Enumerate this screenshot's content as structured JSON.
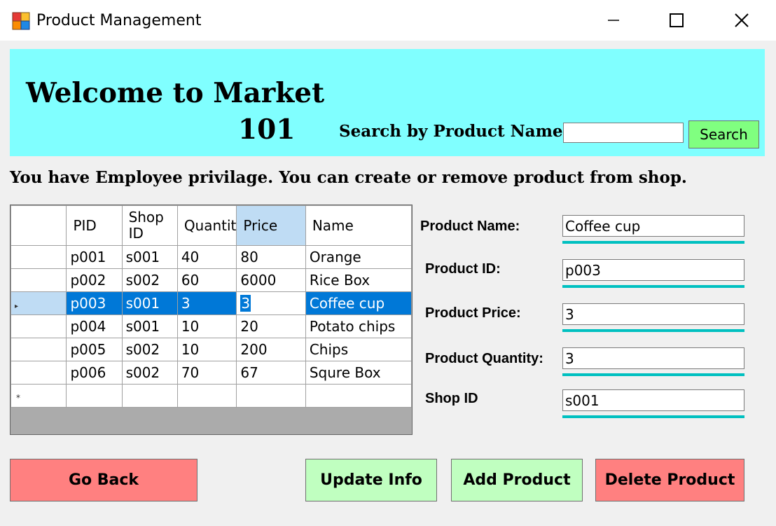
{
  "window": {
    "title": "Product Management",
    "icons": {
      "app": "app-icon",
      "minimize": "minimize-icon",
      "maximize": "maximize-icon",
      "close": "close-icon"
    }
  },
  "banner": {
    "welcome_line1": "Welcome to Market",
    "welcome_line2": "101",
    "background": "#80ffff",
    "search_label": "Search by Product  Name",
    "search_value": "",
    "search_button": "Search"
  },
  "privilege_text": "You have Employee privilage. You can create or remove product from shop.",
  "grid": {
    "columns": [
      "PID",
      "Shop ID",
      "Quantity",
      "Price",
      "Name"
    ],
    "column_display": [
      "PID",
      "Shop\nID",
      "Quantit",
      "Price",
      "Name"
    ],
    "rows": [
      [
        "p001",
        "s001",
        "40",
        "80",
        "Orange"
      ],
      [
        "p002",
        "s002",
        "60",
        "6000",
        "Rice Box"
      ],
      [
        "p003",
        "s001",
        "3",
        "3",
        "Coffee cup"
      ],
      [
        "p004",
        "s001",
        "10",
        "20",
        "Potato chips"
      ],
      [
        "p005",
        "s002",
        "10",
        "200",
        "Chips"
      ],
      [
        "p006",
        "s002",
        "70",
        "67",
        "Squre Box"
      ]
    ],
    "selected_row": 2,
    "selection_color": "#0078d7",
    "new_row_marker": "*",
    "current_row_marker": "▸"
  },
  "form": {
    "product_name": {
      "label": "Product Name:",
      "value": "Coffee cup"
    },
    "product_id": {
      "label": "Product ID:",
      "value": "p003"
    },
    "product_price": {
      "label": "Product Price:",
      "value": "3"
    },
    "product_quantity": {
      "label": "Product Quantity:",
      "value": "3"
    },
    "shop_id": {
      "label": "Shop ID",
      "value": "s001"
    },
    "underline_color": "#00c0c0"
  },
  "buttons": {
    "go_back": "Go Back",
    "update_info": "Update Info",
    "add_product": "Add Product",
    "delete_product": "Delete Product",
    "red_color": "#ff8080",
    "green_color": "#c0ffc0"
  }
}
